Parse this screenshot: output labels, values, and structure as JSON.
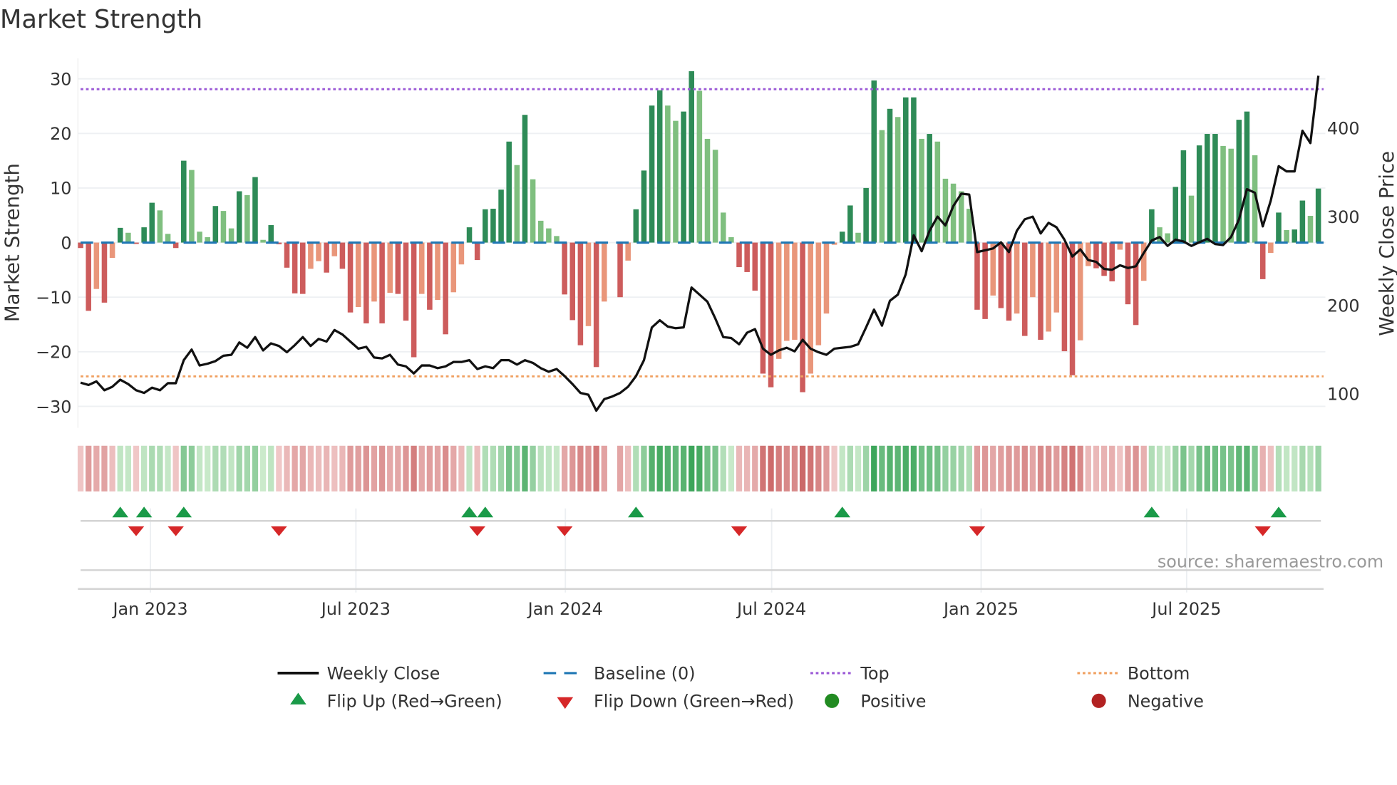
{
  "title": "Market Strength",
  "source": "source: sharemaestro.com",
  "colors": {
    "strong_green": "#2e8b57",
    "light_green": "#7fbf7f",
    "strong_red": "#cd5c5c",
    "light_red": "#e9967a",
    "baseline": "#1f77b4",
    "top": "#9b59d6",
    "bottom": "#f0a060",
    "close": "#111111",
    "flip_up": "#1a9a48",
    "flip_down": "#d62728",
    "positive": "#228b22",
    "negative": "#b22222"
  },
  "legend": {
    "weekly_close": "Weekly Close",
    "baseline": "Baseline (0)",
    "top": "Top",
    "bottom": "Bottom",
    "flip_up": "Flip Up (Red→Green)",
    "flip_down": "Flip Down (Green→Red)",
    "positive": "Positive",
    "negative": "Negative"
  },
  "chart_data": {
    "type": "bar",
    "title": "Market Strength",
    "ylabel": "Market Strength",
    "y2label": "Weekly Close Price",
    "ylim": [
      -35,
      33
    ],
    "y2lim": [
      80,
      470
    ],
    "yticks": [
      30,
      20,
      10,
      0,
      -10,
      -20,
      -30
    ],
    "y2ticks": [
      100,
      200,
      300,
      400
    ],
    "top_level": 28.1,
    "bottom_level": -24.5,
    "baseline": 0,
    "frequency": "weekly",
    "xticks": [
      {
        "label": "Jan 2023",
        "week": 8.8
      },
      {
        "label": "Jul 2023",
        "week": 34.7
      },
      {
        "label": "Jan 2024",
        "week": 61.1
      },
      {
        "label": "Jul 2024",
        "week": 87.1
      },
      {
        "label": "Jan 2025",
        "week": 113.5
      },
      {
        "label": "Jul 2025",
        "week": 139.4
      }
    ],
    "strength": [
      -1,
      -12.5,
      -8.5,
      -11,
      -2.8,
      2.7,
      1.8,
      -0.2,
      2.8,
      7.3,
      5.9,
      1.6,
      -1,
      15,
      13.3,
      2,
      1,
      6.7,
      5.8,
      2.6,
      9.4,
      8.7,
      12,
      0.5,
      3.2,
      -0.3,
      -4.6,
      -9.3,
      -9.4,
      -4.8,
      -3.4,
      -5.5,
      -2.5,
      -4.8,
      -12.8,
      -11.8,
      -14.8,
      -10.8,
      -14.8,
      -9.2,
      -9.4,
      -14.3,
      -21,
      -9.4,
      -12.3,
      -10.5,
      -16.8,
      -9.1,
      -4,
      2.8,
      -3.2,
      6.1,
      6.2,
      9.7,
      18.5,
      14.2,
      23.4,
      11.6,
      4,
      2.6,
      1.2,
      -9.5,
      -14.2,
      -18.8,
      -15.3,
      -22.8,
      -10.8,
      0,
      -10,
      -3.3,
      6.1,
      13.2,
      25.1,
      27.9,
      25.1,
      22.3,
      24,
      31.4,
      27.8,
      19,
      17,
      5.5,
      1,
      -4.5,
      -5.4,
      -8.8,
      -24,
      -26.5,
      -21.3,
      -18,
      -17.8,
      -27.4,
      -24,
      -18.8,
      -13,
      -0.4,
      2,
      6.8,
      1.8,
      10,
      29.7,
      20.6,
      24.5,
      23,
      26.6,
      26.6,
      19,
      19.9,
      18.5,
      11.7,
      10.8,
      9.4,
      6.2,
      -12.3,
      -14,
      -9.7,
      -12,
      -14.3,
      -13,
      -17.1,
      -10,
      -17.8,
      -16.3,
      -12.8,
      -19.9,
      -24.3,
      -17.9,
      -4.3,
      -4.7,
      -6.1,
      -7.1,
      -1.3,
      -11.3,
      -15.1,
      -7,
      6.1,
      2.8,
      1.7,
      10.2,
      16.9,
      8.6,
      17.8,
      19.9,
      19.9,
      17.7,
      17.2,
      22.5,
      24,
      16,
      -6.7,
      -1.9,
      5.5,
      2.3,
      2.4,
      7.7,
      4.9,
      9.9
    ],
    "weekly_close": [
      112.6,
      110,
      114,
      104,
      108,
      116,
      111,
      104,
      101,
      107,
      104,
      112,
      112,
      138,
      150,
      132,
      134,
      137,
      143,
      144,
      158,
      152,
      164,
      149,
      157,
      154,
      147,
      155,
      164,
      154,
      162,
      159,
      172,
      167,
      159,
      151,
      153,
      141,
      140,
      144,
      133,
      131,
      123,
      132,
      132,
      129,
      131,
      136,
      136,
      138,
      128,
      131,
      129,
      138,
      138,
      133,
      138,
      135,
      129,
      125,
      128,
      120,
      111,
      101,
      99,
      81,
      94,
      97,
      101,
      108,
      120,
      138,
      175,
      183,
      176,
      174,
      175,
      220,
      212,
      204,
      185,
      164,
      163,
      156,
      169,
      173,
      151,
      144,
      149,
      152,
      148,
      161,
      151,
      147,
      144,
      151,
      152,
      153,
      156,
      175,
      195,
      177,
      205,
      212,
      235,
      279,
      261,
      284,
      300,
      290,
      312,
      326,
      325,
      260,
      262,
      264,
      271,
      260,
      284,
      297,
      300,
      281,
      293,
      288,
      274,
      255,
      263,
      251,
      249,
      241,
      240,
      245,
      242,
      244,
      259,
      273,
      277,
      267,
      274,
      272,
      267,
      271,
      275,
      269,
      268,
      277,
      297,
      331,
      327,
      289,
      318,
      357,
      351,
      351,
      397,
      383,
      459
    ]
  }
}
